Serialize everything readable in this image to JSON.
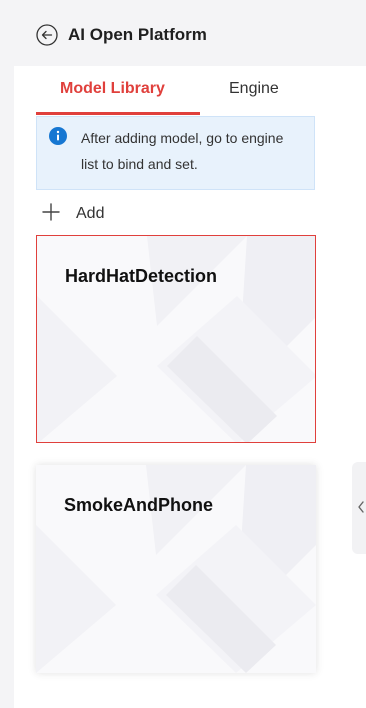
{
  "header": {
    "title": "AI Open Platform",
    "back_icon": "back-arrow-circle-icon"
  },
  "tabs": [
    {
      "label": "Model Library",
      "active": true
    },
    {
      "label": "Engine",
      "active": false
    }
  ],
  "info": {
    "icon": "info-icon",
    "text": "After adding model, go to engine list to bind and set."
  },
  "add": {
    "icon": "plus-icon",
    "label": "Add"
  },
  "models": [
    {
      "name": "HardHatDetection",
      "selected": true
    },
    {
      "name": "SmokeAndPhone",
      "selected": false
    }
  ],
  "colors": {
    "accent": "#e0403c",
    "info_bg": "#e8f2fc",
    "info_icon": "#1677d2"
  }
}
